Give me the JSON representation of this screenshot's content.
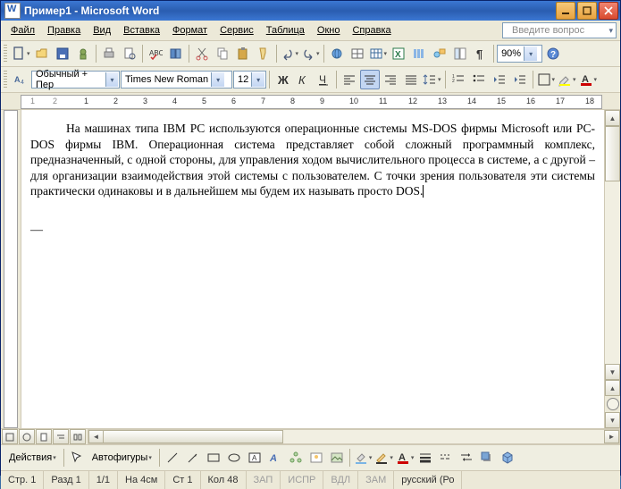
{
  "title": "Пример1 - Microsoft Word",
  "menu": {
    "file": "Файл",
    "edit": "Правка",
    "view": "Вид",
    "insert": "Вставка",
    "format": "Формат",
    "tools": "Сервис",
    "table": "Таблица",
    "window": "Окно",
    "help": "Справка"
  },
  "help_placeholder": "Введите вопрос",
  "toolbar1": {
    "zoom": "90%"
  },
  "toolbar2": {
    "style": "Обычный + Пер",
    "font": "Times New Roman",
    "size": "12"
  },
  "ruler_numbers": [
    "1",
    "2",
    "1",
    "2",
    "3",
    "4",
    "5",
    "6",
    "7",
    "8",
    "9",
    "10",
    "11",
    "12",
    "13",
    "14",
    "15",
    "16",
    "17",
    "18"
  ],
  "doc_text": "На машинах типа IBM PC используются операционные системы MS-DOS фирмы Microsoft или PC-DOS фирмы IBM. Операционная система представляет собой сложный программный комплекс, предназначенный, с одной стороны, для управления ходом вычислительного процесса в системе, а с другой – для организации взаимодействия этой системы с пользователем. С точки зрения пользователя эти системы практически одинаковы и в дальнейшем мы будем их называть просто DOS.",
  "dash": "—",
  "drawbar": {
    "actions": "Действия",
    "autoshapes": "Автофигуры"
  },
  "status": {
    "page_lbl": "Стр.",
    "page": "1",
    "sect_lbl": "Разд",
    "sect": "1",
    "pages": "1/1",
    "at_lbl": "На",
    "at": "4см",
    "ln_lbl": "Ст",
    "ln": "1",
    "col_lbl": "Кол",
    "col": "48",
    "rec": "ЗАП",
    "trk": "ИСПР",
    "ext": "ВДЛ",
    "ovr": "ЗАМ",
    "lang": "русский (Ро"
  }
}
